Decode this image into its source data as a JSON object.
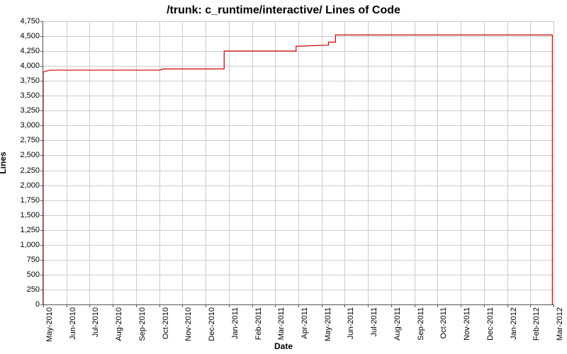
{
  "chart_data": {
    "type": "line",
    "title": "/trunk: c_runtime/interactive/ Lines of Code",
    "xlabel": "Date",
    "ylabel": "Lines",
    "ylim": [
      0,
      4750
    ],
    "y_ticks": [
      0,
      250,
      500,
      750,
      1000,
      1250,
      1500,
      1750,
      2000,
      2250,
      2500,
      2750,
      3000,
      3250,
      3500,
      3750,
      4000,
      4250,
      4500,
      4750
    ],
    "y_tick_labels": [
      "0",
      "250",
      "500",
      "750",
      "1,000",
      "1,250",
      "1,500",
      "1,750",
      "2,000",
      "2,250",
      "2,500",
      "2,750",
      "3,000",
      "3,250",
      "3,500",
      "3,750",
      "4,000",
      "4,250",
      "4,500",
      "4,750"
    ],
    "x_categories": [
      "May-2010",
      "Jun-2010",
      "Jul-2010",
      "Aug-2010",
      "Sep-2010",
      "Oct-2010",
      "Nov-2010",
      "Dec-2010",
      "Jan-2011",
      "Feb-2011",
      "Mar-2011",
      "Apr-2011",
      "May-2011",
      "Jun-2011",
      "Jul-2011",
      "Aug-2011",
      "Sep-2011",
      "Oct-2011",
      "Nov-2011",
      "Dec-2011",
      "Jan-2012",
      "Feb-2012",
      "Mar-2012"
    ],
    "series": [
      {
        "name": "Lines of Code",
        "color": "#cc0000",
        "points": [
          {
            "x": 0,
            "y": 0
          },
          {
            "x": 0,
            "y": 3900
          },
          {
            "x": 0.3,
            "y": 3930
          },
          {
            "x": 5.0,
            "y": 3930
          },
          {
            "x": 5.2,
            "y": 3950
          },
          {
            "x": 7.8,
            "y": 3950
          },
          {
            "x": 7.8,
            "y": 4250
          },
          {
            "x": 10.9,
            "y": 4250
          },
          {
            "x": 10.9,
            "y": 4330
          },
          {
            "x": 12.3,
            "y": 4350
          },
          {
            "x": 12.3,
            "y": 4400
          },
          {
            "x": 12.6,
            "y": 4400
          },
          {
            "x": 12.6,
            "y": 4520
          },
          {
            "x": 21.95,
            "y": 4520
          },
          {
            "x": 21.95,
            "y": 0
          }
        ]
      }
    ]
  }
}
